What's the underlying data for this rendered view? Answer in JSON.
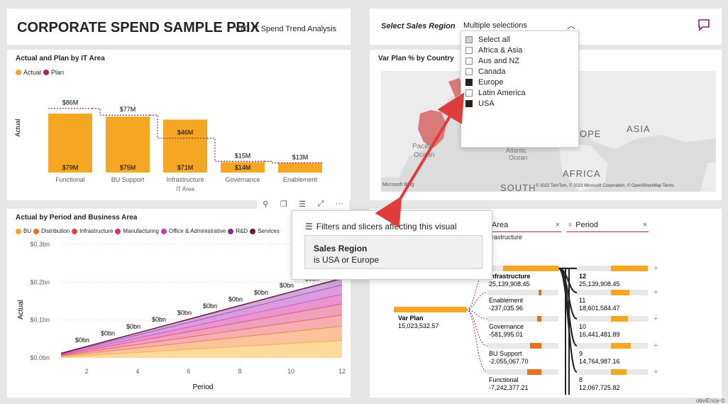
{
  "header": {
    "title": "CORPORATE SPEND SAMPLE PBIX",
    "subtitle": "YTD IT Spend Trend Analysis"
  },
  "slicer": {
    "label": "Select Sales Region",
    "value": "Multiple selections",
    "options": [
      {
        "label": "Select all",
        "state": "partial"
      },
      {
        "label": "Africa & Asia",
        "state": "unchecked"
      },
      {
        "label": "Aus and NZ",
        "state": "unchecked"
      },
      {
        "label": "Canada",
        "state": "unchecked"
      },
      {
        "label": "Europe",
        "state": "checked"
      },
      {
        "label": "Latin America",
        "state": "unchecked"
      },
      {
        "label": "USA",
        "state": "checked"
      }
    ]
  },
  "bar_chart": {
    "title": "Actual and Plan by IT Area",
    "legend": [
      {
        "label": "Actual",
        "color": "#f5a623"
      },
      {
        "label": "Plan",
        "color": "#a2236e"
      }
    ],
    "ylabel": "Actual",
    "xlabel": "IT Area"
  },
  "map": {
    "title": "Var Plan % by Country",
    "labels": {
      "pacific": "Pacific",
      "ocean": "Ocean",
      "atlantic": "Atlantic",
      "atlantic_ocean": "Ocean",
      "europe": "OPE",
      "asia": "ASIA",
      "africa": "AFRICA",
      "south": "SOUTH",
      "bing": "Microsoft Bing"
    },
    "attribution": "© 2022 TomTom, © 2023 Microsoft Corporation, © OpenStreetMap  Terms"
  },
  "area_chart": {
    "title": "Actual by Period and Business Area",
    "legend": [
      {
        "label": "BU",
        "color": "#f5a623"
      },
      {
        "label": "Distribution",
        "color": "#e8711d"
      },
      {
        "label": "Infrastructure",
        "color": "#e04545"
      },
      {
        "label": "Manufacturing",
        "color": "#d6336c"
      },
      {
        "label": "Office & Administrative",
        "color": "#c83fb4"
      },
      {
        "label": "R&D",
        "color": "#8b2f8f"
      },
      {
        "label": "Services",
        "color": "#6b1a3a"
      }
    ],
    "ylabel": "Actual",
    "xlabel": "Period",
    "yticks": [
      "$0.3bn",
      "$0.2bn",
      "$0.1bn",
      "$0.0bn"
    ],
    "xticks": [
      "2",
      "4",
      "6",
      "8",
      "10",
      "12"
    ],
    "point_label": "$0bn"
  },
  "visual_header": {
    "pin": "⚲",
    "copy": "❐",
    "filter": "☰",
    "focus": "⤢",
    "more": "···"
  },
  "filter_popup": {
    "heading": "Filters and slicers affecting this visual",
    "filter_name": "Sales Region",
    "filter_value": "is USA or Europe"
  },
  "decomp_tree": {
    "col1_header": "Area",
    "col1_sub": "rastructure",
    "col2_header": "Period",
    "root_label": "Var Plan",
    "root_value": "15,023,532.57",
    "areas": [
      {
        "label": "Infrastructure",
        "value": "25,139,908.45"
      },
      {
        "label": "Enablement",
        "value": "-237,035.96"
      },
      {
        "label": "Governance",
        "value": "-581,995.01"
      },
      {
        "label": "BU Support",
        "value": "-2,055,067.70"
      },
      {
        "label": "Functional",
        "value": "-7,242,377.21"
      }
    ],
    "periods": [
      {
        "label": "12",
        "value": "25,139,908.45"
      },
      {
        "label": "11",
        "value": "18,601,584.47"
      },
      {
        "label": "10",
        "value": "16,441,481.89"
      },
      {
        "label": "9",
        "value": "14,764,987.16"
      },
      {
        "label": "8",
        "value": "12,067,725.82"
      }
    ]
  },
  "watermark": "obviEnce ©",
  "chart_data": [
    {
      "type": "bar",
      "title": "Actual and Plan by IT Area",
      "categories": [
        "Functional",
        "BU Support",
        "Infrastructure",
        "Governance",
        "Enablement"
      ],
      "series": [
        {
          "name": "Actual",
          "values": [
            79,
            75,
            71,
            14,
            13
          ],
          "labels": [
            "$79M",
            "$75M",
            "$71M",
            "$14M",
            ""
          ]
        },
        {
          "name": "Plan",
          "values": [
            86,
            77,
            46,
            15,
            13
          ],
          "labels": [
            "$86M",
            "$77M",
            "$46M",
            "$15M",
            "$13M"
          ]
        }
      ],
      "ylim": [
        0,
        95
      ],
      "ylabel": "Actual",
      "xlabel": "IT Area"
    },
    {
      "type": "area",
      "title": "Actual by Period and Business Area",
      "x": [
        1,
        2,
        3,
        4,
        5,
        6,
        7,
        8,
        9,
        10,
        11,
        12
      ],
      "series_totals": [
        0.012,
        0.03,
        0.048,
        0.066,
        0.084,
        0.102,
        0.12,
        0.138,
        0.156,
        0.174,
        0.192,
        0.21
      ],
      "layer_fractions": [
        0.22,
        0.18,
        0.14,
        0.14,
        0.12,
        0.12,
        0.08
      ],
      "ylim": [
        0,
        0.3
      ],
      "ylabel": "Actual",
      "xlabel": "Period"
    }
  ]
}
